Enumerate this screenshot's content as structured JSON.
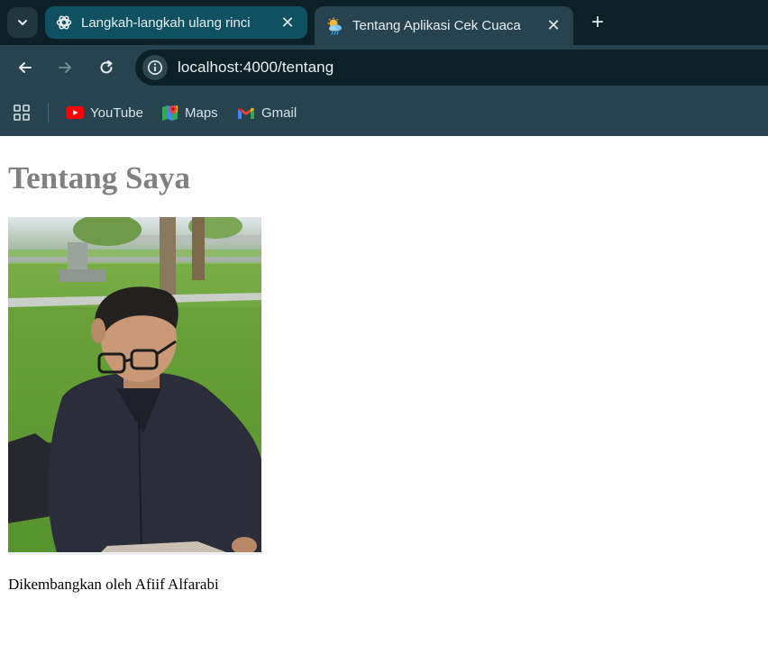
{
  "browser": {
    "tabs": [
      {
        "title": "Langkah-langkah ulang rinci",
        "icon": "chatgpt-icon",
        "active": false
      },
      {
        "title": "Tentang Aplikasi Cek Cuaca",
        "icon": "weather-icon",
        "active": true
      }
    ],
    "address_bar": {
      "url": "localhost:4000/tentang"
    },
    "bookmarks": [
      {
        "label": "YouTube",
        "icon": "youtube-icon"
      },
      {
        "label": "Maps",
        "icon": "maps-icon"
      },
      {
        "label": "Gmail",
        "icon": "gmail-icon"
      }
    ]
  },
  "page": {
    "heading": "Tentang Saya",
    "caption": "Dikembangkan oleh Afiif Alfarabi"
  },
  "colors": {
    "tab_active": "#27434f",
    "tab_inactive": "#0f5161",
    "heading": "#808080"
  }
}
